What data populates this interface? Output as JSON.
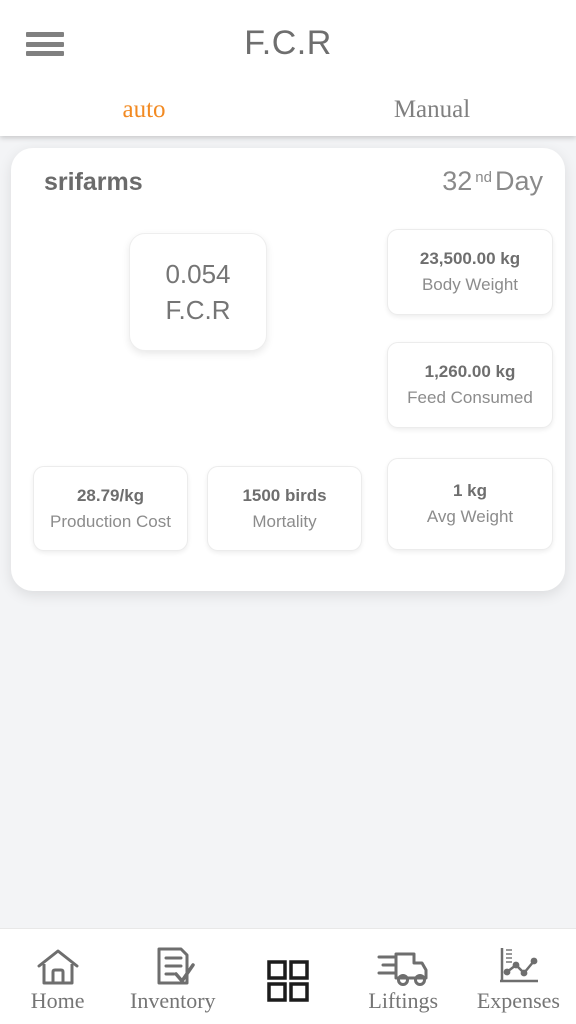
{
  "header": {
    "title": "F.C.R",
    "menu_icon": "hamburger-icon"
  },
  "tabs": [
    {
      "label": "auto",
      "active": true,
      "color": "#f28a22"
    },
    {
      "label": "Manual",
      "active": false,
      "color": "#808080"
    }
  ],
  "card": {
    "farm_name": "srifarms",
    "day": {
      "number": "32",
      "ordinal_suffix": "nd",
      "unit": "Day"
    },
    "fcr_tile": {
      "value": "0.054",
      "label": "F.C.R"
    },
    "stats": [
      {
        "value": "23,500.00 kg",
        "label": "Body Weight"
      },
      {
        "value": "1,260.00 kg",
        "label": "Feed Consumed"
      },
      {
        "value": "1 kg",
        "label": "Avg Weight"
      },
      {
        "value": "28.79/kg",
        "label": "Production Cost"
      },
      {
        "value": "1500 birds",
        "label": "Mortality"
      }
    ]
  },
  "bottom_nav": [
    {
      "label": "Home",
      "icon": "home-icon",
      "active": false
    },
    {
      "label": "Inventory",
      "icon": "document-check-icon",
      "active": false
    },
    {
      "label": "",
      "icon": "grid-icon",
      "active": true
    },
    {
      "label": "Liftings",
      "icon": "truck-icon",
      "active": false
    },
    {
      "label": "Expenses",
      "icon": "line-chart-icon",
      "active": false
    }
  ],
  "theme": {
    "background": "#f3f4f6",
    "surface": "#ffffff",
    "accent": "#f28a22",
    "text_muted": "#8c8c8c",
    "text_strong": "#6e6e6e"
  }
}
